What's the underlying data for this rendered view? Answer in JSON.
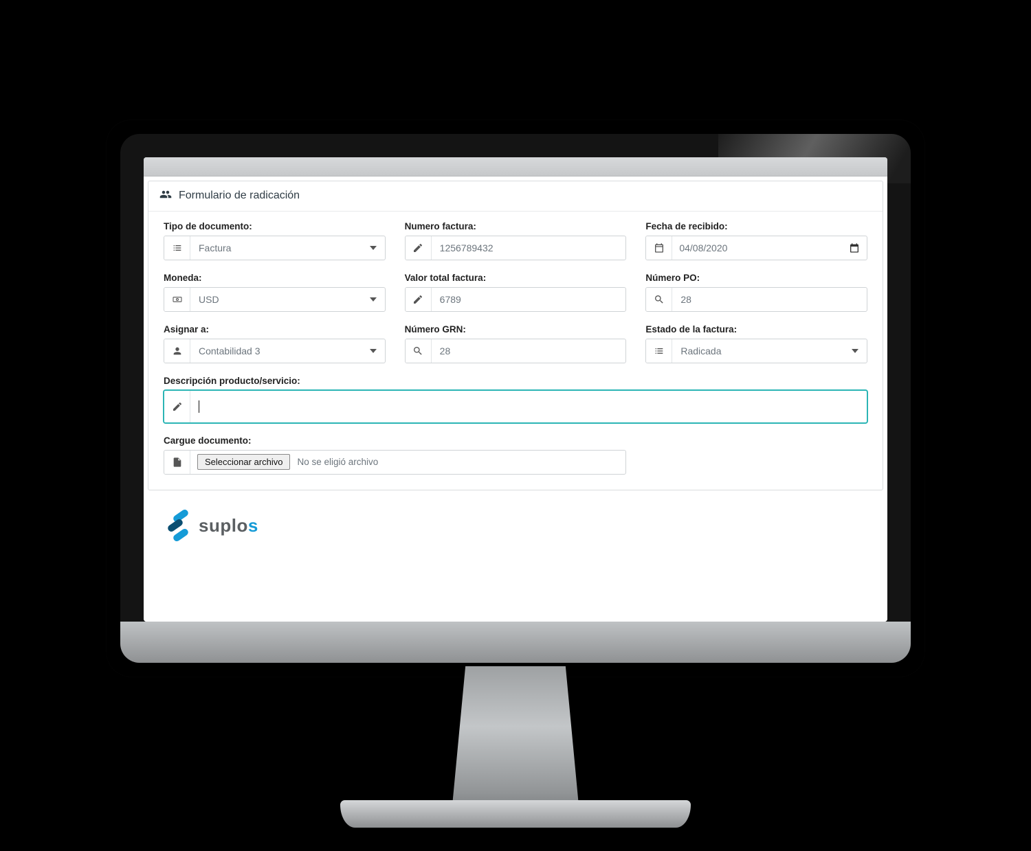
{
  "panel": {
    "title": "Formulario de radicación"
  },
  "labels": {
    "tipo_documento": "Tipo de documento:",
    "numero_factura": "Numero factura:",
    "fecha_recibido": "Fecha de recibido:",
    "moneda": "Moneda:",
    "valor_total": "Valor total factura:",
    "numero_po": "Número PO:",
    "asignar_a": "Asignar a:",
    "numero_grn": "Número GRN:",
    "estado_factura": "Estado de la factura:",
    "descripcion": "Descripción producto/servicio:",
    "cargue_doc": "Cargue documento:"
  },
  "values": {
    "tipo_documento": "Factura",
    "numero_factura": "1256789432",
    "fecha_recibido": "04/08/2020",
    "moneda": "USD",
    "valor_total": "6789",
    "numero_po": "28",
    "asignar_a": "Contabilidad 3",
    "numero_grn": "28",
    "estado_factura": "Radicada",
    "descripcion": ""
  },
  "file": {
    "button": "Seleccionar archivo",
    "status": "No se eligió archivo"
  },
  "brand": {
    "name_a": "suplo",
    "name_b": "s"
  }
}
